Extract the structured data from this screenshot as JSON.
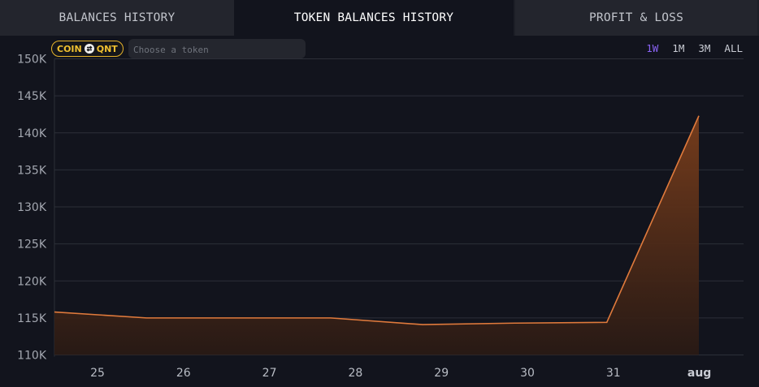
{
  "tabs": [
    {
      "label": "BALANCES HISTORY"
    },
    {
      "label": "TOKEN BALANCES HISTORY"
    },
    {
      "label": "PROFIT & LOSS"
    }
  ],
  "filters": {
    "pill_left": "COIN",
    "pill_right": "QNT",
    "token_placeholder": "Choose a token",
    "token_value": ""
  },
  "ranges": [
    "1W",
    "1M",
    "3M",
    "ALL"
  ],
  "active_range": "1W",
  "colors": {
    "background": "#12141d",
    "line": "#e07a3c",
    "area_top": "#7a3e1c",
    "area_bottom": "#2a1a14",
    "grid": "#2c2f38",
    "active_range": "#8a63f5",
    "pill": "#e6b32a"
  },
  "chart_data": {
    "type": "area",
    "x": [
      "25",
      "26",
      "27",
      "28",
      "29",
      "30",
      "31",
      "aug"
    ],
    "series": [
      {
        "values": [
          115800,
          115000,
          115000,
          115000,
          114100,
          114300,
          114400,
          142300
        ]
      }
    ],
    "y_ticks": [
      "110K",
      "115K",
      "120K",
      "125K",
      "130K",
      "135K",
      "140K",
      "145K",
      "150K"
    ],
    "ylim": [
      110000,
      150000
    ],
    "grid": true,
    "bold_tick": "aug"
  }
}
